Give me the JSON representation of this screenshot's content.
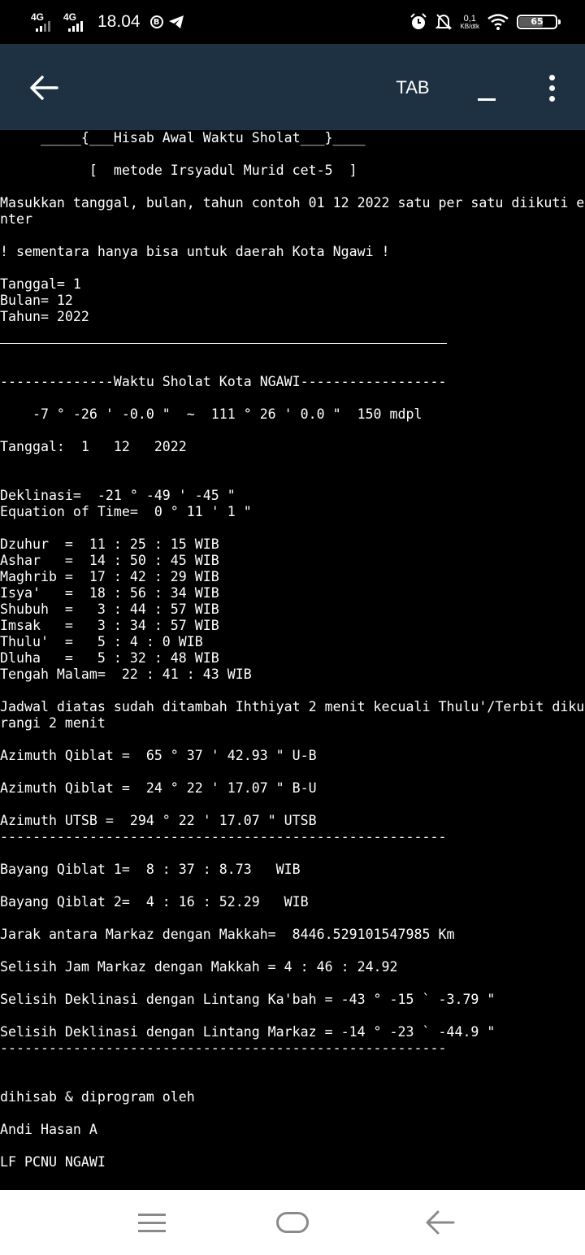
{
  "status_bar": {
    "signal1": "4G",
    "signal2": "4G",
    "time": "18.04",
    "b_icon": "B",
    "net_speed_value": "0,1",
    "net_speed_unit": "KB/dtk",
    "battery": "65",
    "battery_level": 0.65
  },
  "app_bar": {
    "back_icon": "arrow-left",
    "tab_label": "TAB",
    "underscore_icon": "underscore",
    "more_icon": "vertical-dots",
    "background": "#1d3142"
  },
  "terminal": {
    "header_title": "     _____{___Hisab Awal Waktu Sholat___}____",
    "header_method": "           [  metode Irsyadul Murid cet-5  ]",
    "input_prompt": "Masukkan tanggal, bulan, tahun contoh 01 12 2022 satu per satu diikuti enter",
    "note": "! sementara hanya bisa untuk daerah Kota Ngawi !",
    "input_tanggal": "Tanggal= 1",
    "input_bulan": "Bulan= 12",
    "input_tahun": "Tahun= 2022",
    "section_title": "--------------Waktu Sholat Kota NGAWI------------------",
    "coordinates": "    -7 ° -26 ' -0.0 \"  ~  111 ° 26 ' 0.0 \"  150 mdpl",
    "date_line": "Tanggal:  1   12   2022",
    "deklinasi": "Deklinasi=  -21 ° -49 ' -45 \"",
    "equation_of_time": "Equation of Time=  0 ° 11 ' 1 \"",
    "prayer_times": [
      "Dzuhur  =  11 : 25 : 15 WIB",
      "Ashar   =  14 : 50 : 45 WIB",
      "Maghrib =  17 : 42 : 29 WIB",
      "Isya'   =  18 : 56 : 34 WIB",
      "Shubuh  =   3 : 44 : 57 WIB",
      "Imsak   =   3 : 34 : 57 WIB",
      "Thulu'  =   5 : 4 : 0 WIB",
      "Dluha   =   5 : 32 : 48 WIB",
      "Tengah Malam=  22 : 41 : 43 WIB"
    ],
    "ihthiyat_note": "Jadwal diatas sudah ditambah Ihthiyat 2 menit kecuali Thulu'/Terbit dikurangi 2 menit",
    "azimuth_qiblat_ub": "Azimuth Qiblat =  65 ° 37 ' 42.93 \" U-B",
    "azimuth_qiblat_bu": "Azimuth Qiblat =  24 ° 22 ' 17.07 \" B-U",
    "azimuth_utsb": "Azimuth UTSB =  294 ° 22 ' 17.07 \" UTSB",
    "dash_line": "-------------------------------------------------------",
    "bayang_qiblat_1": "Bayang Qiblat 1=  8 : 37 : 8.73   WIB",
    "bayang_qiblat_2": "Bayang Qiblat 2=  4 : 16 : 52.29   WIB",
    "jarak": "Jarak antara Markaz dengan Makkah=  8446.529101547985 Km",
    "selisih_jam": "Selisih Jam Markaz dengan Makkah = 4 : 46 : 24.92",
    "selisih_deklinasi_kabah": "Selisih Deklinasi dengan Lintang Ka'bah = -43 ° -15 ` -3.79 \"",
    "selisih_deklinasi_markaz": "Selisih Deklinasi dengan Lintang Markaz = -14 ° -23 ` -44.9 \"",
    "credit_line_1": "dihisab & diprogram oleh",
    "credit_line_2": "Andi Hasan A",
    "credit_line_3": "LF PCNU NGAWI"
  },
  "nav_bar": {
    "menu_icon": "recent-apps",
    "home_icon": "home",
    "back_icon": "back"
  }
}
